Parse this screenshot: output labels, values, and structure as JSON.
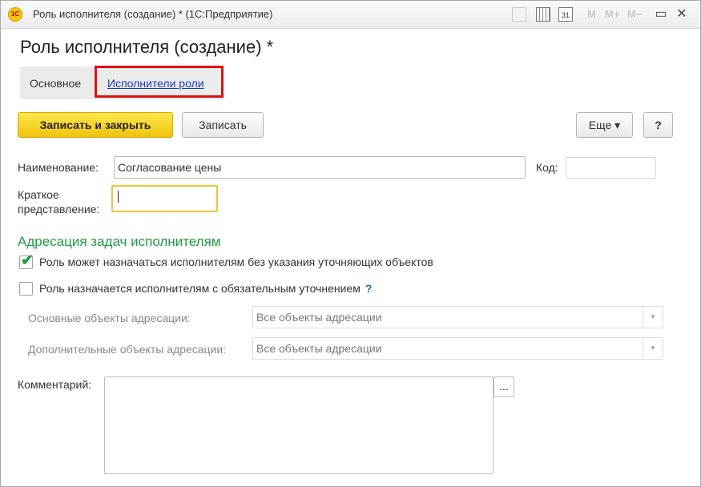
{
  "window": {
    "title": "Роль исполнителя (создание) * (1С:Предприятие)",
    "logo_text": "1С",
    "toolbar": {
      "m_label": "M",
      "m_plus_label": "M+",
      "m_minus_label": "M−",
      "calendar_label": "31",
      "minimize_glyph": "▭",
      "close_glyph": "✕"
    }
  },
  "form": {
    "title": "Роль исполнителя (создание) *",
    "tabs": [
      {
        "label": "Основное"
      },
      {
        "label": "Исполнители роли"
      }
    ],
    "buttons": {
      "save_close": "Записать и закрыть",
      "save": "Записать",
      "more": "Еще ▾",
      "help": "?"
    },
    "fields": {
      "name_label": "Наименование:",
      "name_value": "Согласование цены",
      "code_label": "Код:",
      "code_value": "",
      "short_label_line1": "Краткое",
      "short_label_line2": "представление:",
      "short_value": ""
    },
    "addressing": {
      "section_title": "Адресация задач исполнителям",
      "checkbox1_label": "Роль может назначаться исполнителям без указания уточняющих объектов",
      "checkbox1_checked": true,
      "checkbox2_label": "Роль назначается исполнителям с обязательным уточнением",
      "checkbox2_checked": false,
      "help_mark": "?",
      "main_objects_label": "Основные объекты адресации:",
      "main_objects_value": "Все объекты адресации",
      "extra_objects_label": "Дополнительные объекты адресации:",
      "extra_objects_value": "Все объекты адресации"
    },
    "comment": {
      "label": "Комментарий:",
      "value": "",
      "ellipsis_button": "..."
    }
  }
}
